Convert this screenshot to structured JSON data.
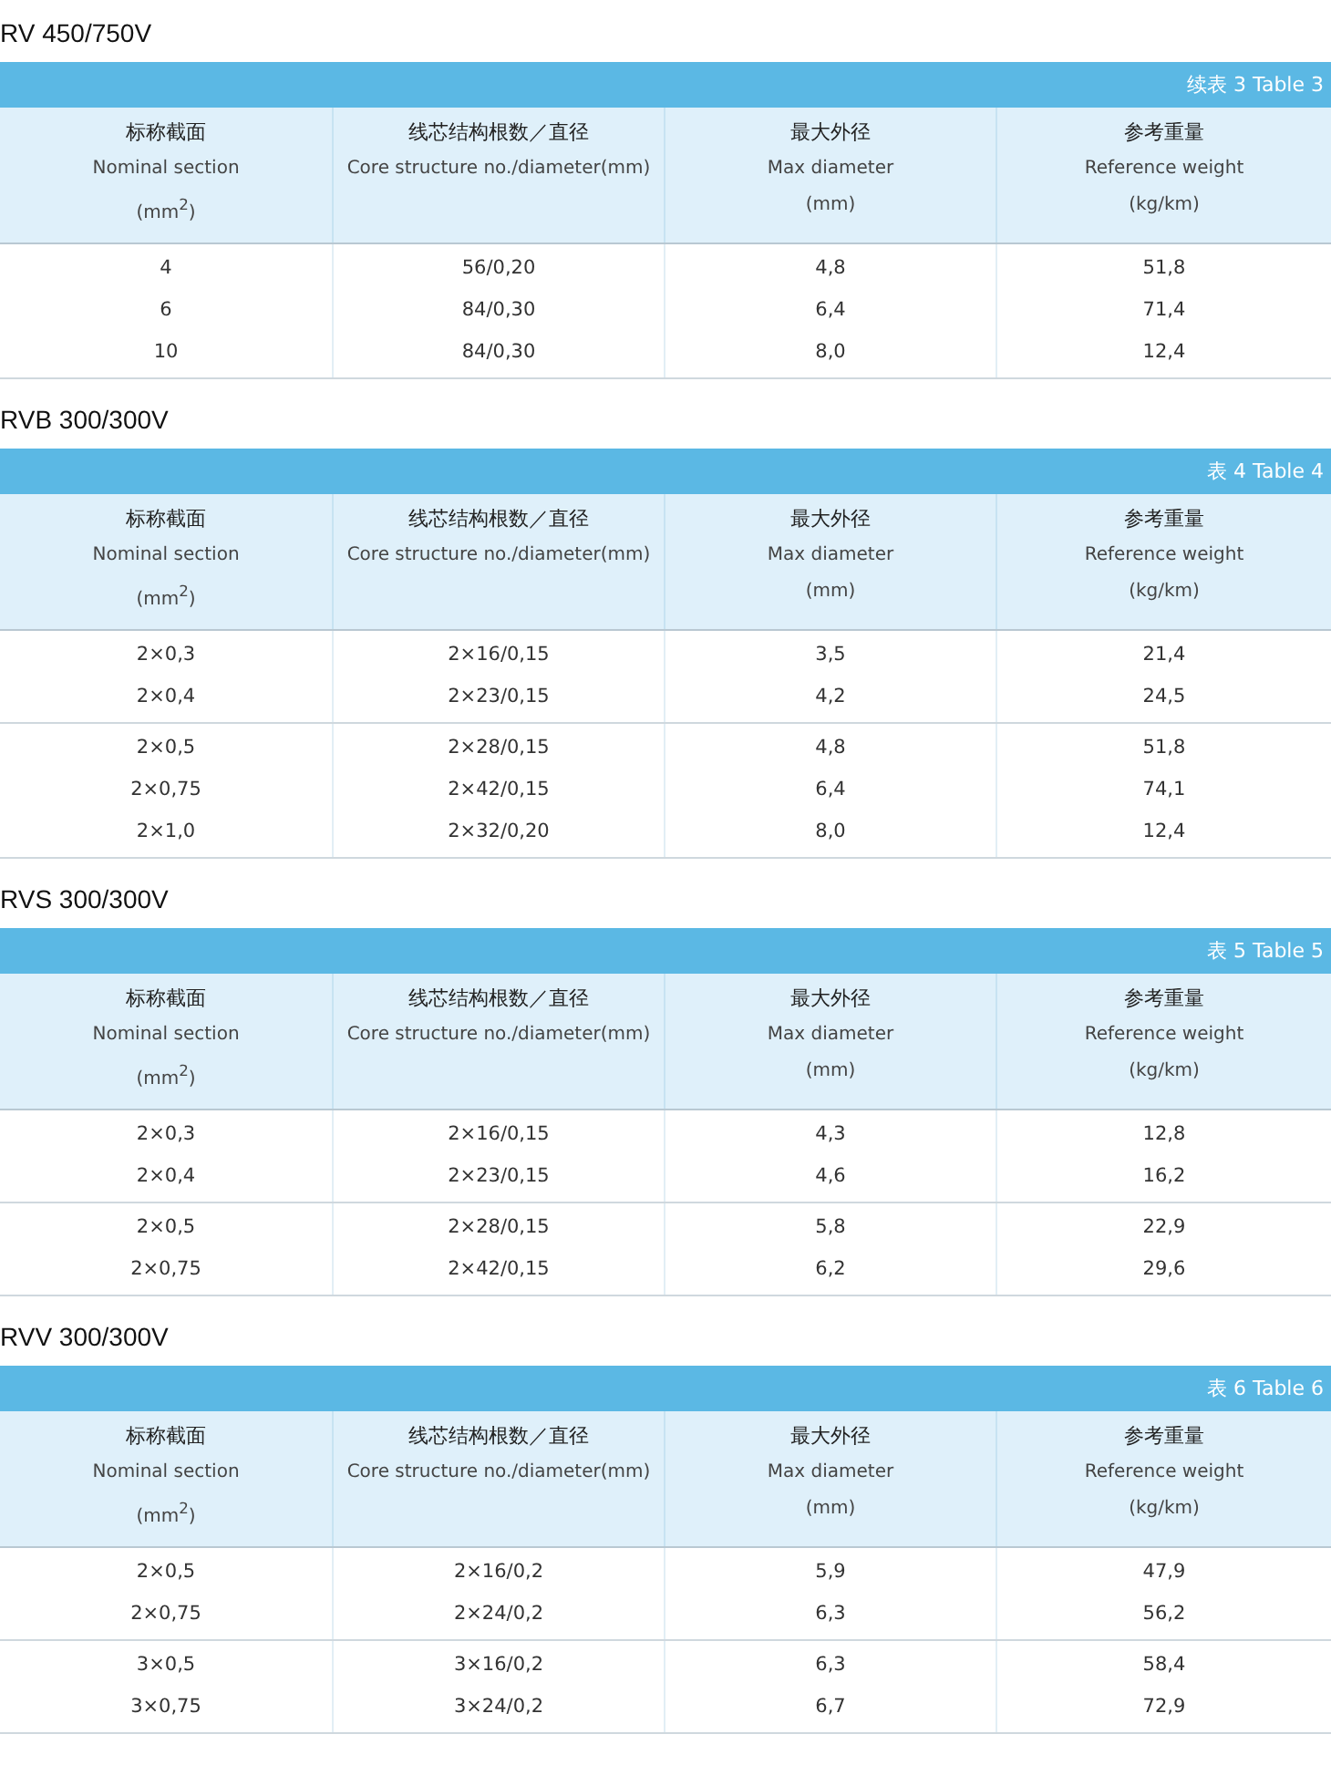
{
  "sections": [
    {
      "title": "RV 450/750V",
      "caption": "续表 3 Table 3",
      "columns": [
        {
          "zh": "标称截面",
          "en": "Nominal section",
          "unit": "(mm$^{2}$)"
        },
        {
          "zh": "线芯结构根数／直径",
          "en": "Core structure no./diameter(mm)"
        },
        {
          "zh": "最大外径",
          "en": "Max diameter",
          "unit": "(mm)"
        },
        {
          "zh": "参考重量",
          "en": "Reference weight",
          "unit": "(kg/km)"
        }
      ],
      "groups": [
        [
          [
            "4",
            "56/0,20",
            "4,8",
            "51,8"
          ],
          [
            "6",
            "84/0,30",
            "6,4",
            "71,4"
          ],
          [
            "10",
            "84/0,30",
            "8,0",
            "12,4"
          ]
        ]
      ]
    },
    {
      "title": "RVB 300/300V",
      "caption": "表 4 Table 4",
      "columns": [
        {
          "zh": "标称截面",
          "en": "Nominal section",
          "unit": "(mm$^{2}$)"
        },
        {
          "zh": "线芯结构根数／直径",
          "en": "Core structure no./diameter(mm)"
        },
        {
          "zh": "最大外径",
          "en": "Max diameter",
          "unit": "(mm)"
        },
        {
          "zh": "参考重量",
          "en": "Reference weight",
          "unit": "(kg/km)"
        }
      ],
      "groups": [
        [
          [
            "2×0,3",
            "2×16/0,15",
            "3,5",
            "21,4"
          ],
          [
            "2×0,4",
            "2×23/0,15",
            "4,2",
            "24,5"
          ]
        ],
        [
          [
            "2×0,5",
            "2×28/0,15",
            "4,8",
            "51,8"
          ],
          [
            "2×0,75",
            "2×42/0,15",
            "6,4",
            "74,1"
          ],
          [
            "2×1,0",
            "2×32/0,20",
            "8,0",
            "12,4"
          ]
        ]
      ]
    },
    {
      "title": "RVS 300/300V",
      "caption": "表 5 Table 5",
      "columns": [
        {
          "zh": "标称截面",
          "en": "Nominal section",
          "unit": "(mm$^{2}$)"
        },
        {
          "zh": "线芯结构根数／直径",
          "en": "Core structure no./diameter(mm)"
        },
        {
          "zh": "最大外径",
          "en": "Max diameter",
          "unit": "(mm)"
        },
        {
          "zh": "参考重量",
          "en": "Reference weight",
          "unit": "(kg/km)"
        }
      ],
      "groups": [
        [
          [
            "2×0,3",
            "2×16/0,15",
            "4,3",
            "12,8"
          ],
          [
            "2×0,4",
            "2×23/0,15",
            "4,6",
            "16,2"
          ]
        ],
        [
          [
            "2×0,5",
            "2×28/0,15",
            "5,8",
            "22,9"
          ],
          [
            "2×0,75",
            "2×42/0,15",
            "6,2",
            "29,6"
          ]
        ]
      ]
    },
    {
      "title": "RVV 300/300V",
      "caption": "表 6 Table 6",
      "columns": [
        {
          "zh": "标称截面",
          "en": "Nominal section",
          "unit": "(mm$^{2}$)"
        },
        {
          "zh": "线芯结构根数／直径",
          "en": "Core structure no./diameter(mm)"
        },
        {
          "zh": "最大外径",
          "en": "Max diameter",
          "unit": "(mm)"
        },
        {
          "zh": "参考重量",
          "en": "Reference weight",
          "unit": "(kg/km)"
        }
      ],
      "groups": [
        [
          [
            "2×0,5",
            "2×16/0,2",
            "5,9",
            "47,9"
          ],
          [
            "2×0,75",
            "2×24/0,2",
            "6,3",
            "56,2"
          ]
        ],
        [
          [
            "3×0,5",
            "3×16/0,2",
            "6,3",
            "58,4"
          ],
          [
            "3×0,75",
            "3×24/0,2",
            "6,7",
            "72,9"
          ]
        ]
      ]
    }
  ]
}
